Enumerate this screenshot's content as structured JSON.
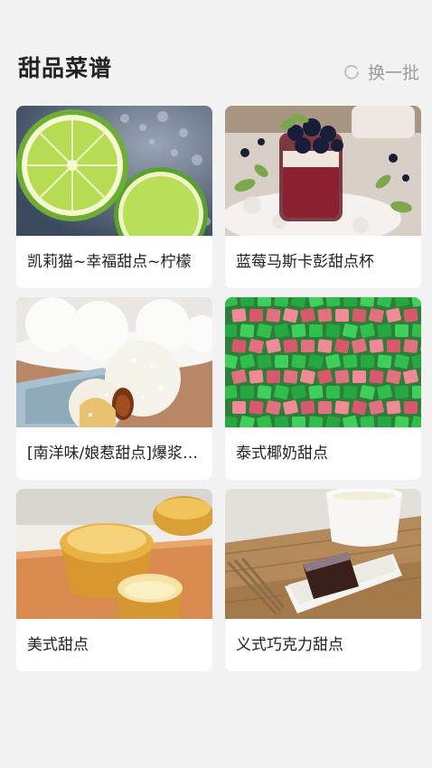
{
  "header": {
    "title": "甜品菜谱",
    "refresh_label": "换一批",
    "refresh_icon": "refresh-icon"
  },
  "recipes": [
    {
      "title": "凯莉猫~幸福甜点~柠檬",
      "image": "lime-slices-image"
    },
    {
      "title": "蓝莓马斯卡彭甜点杯",
      "image": "blueberry-dessert-cup-image"
    },
    {
      "title": "[南洋味/娘惹甜点]爆浆椰丝球",
      "image": "coconut-balls-image"
    },
    {
      "title": "泰式椰奶甜点",
      "image": "jelly-cubes-image"
    },
    {
      "title": "美式甜点",
      "image": "muffins-image"
    },
    {
      "title": "义式巧克力甜点",
      "image": "chocolate-brownie-image"
    }
  ]
}
